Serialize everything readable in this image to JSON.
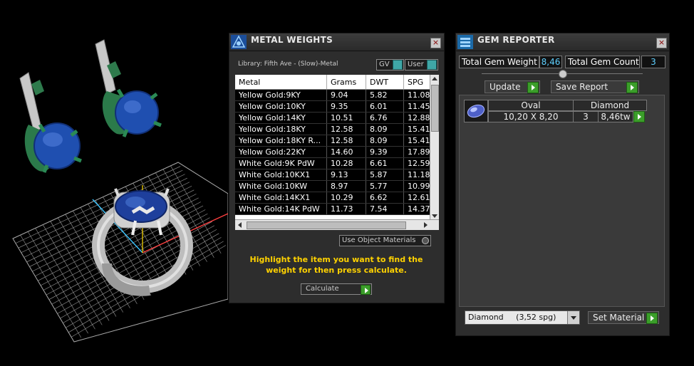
{
  "metal_weights": {
    "title": "METAL WEIGHTS",
    "library": "Library: Fifth Ave - (Slow)-Metal",
    "gv_label": "GV",
    "user_label": "User",
    "columns": [
      "Metal",
      "Grams",
      "DWT",
      "SPG"
    ],
    "rows": [
      [
        "Yellow Gold:9KY",
        "9.04",
        "5.82",
        "11.08"
      ],
      [
        "Yellow Gold:10KY",
        "9.35",
        "6.01",
        "11.45"
      ],
      [
        "Yellow Gold:14KY",
        "10.51",
        "6.76",
        "12.88"
      ],
      [
        "Yellow Gold:18KY",
        "12.58",
        "8.09",
        "15.41"
      ],
      [
        "Yellow Gold:18KY R...",
        "12.58",
        "8.09",
        "15.41"
      ],
      [
        "Yellow Gold:22KY",
        "14.60",
        "9.39",
        "17.89"
      ],
      [
        "White Gold:9K PdW",
        "10.28",
        "6.61",
        "12.59"
      ],
      [
        "White Gold:10KX1",
        "9.13",
        "5.87",
        "11.18"
      ],
      [
        "White Gold:10KW",
        "8.97",
        "5.77",
        "10.99"
      ],
      [
        "White Gold:14KX1",
        "10.29",
        "6.62",
        "12.61"
      ],
      [
        "White Gold:14K PdW",
        "11.73",
        "7.54",
        "14.37"
      ]
    ],
    "use_object_materials": "Use Object Materials",
    "hint": "Highlight the item you want to find the weight for then press calculate.",
    "calculate_label": "Calculate"
  },
  "gem_reporter": {
    "title": "GEM REPORTER",
    "total_weight_label": "Total Gem Weight",
    "total_weight_value": "8,46",
    "total_count_label": "Total Gem Count",
    "total_count_value": "3",
    "update_label": "Update",
    "save_report_label": "Save Report",
    "gem_shape": "Oval",
    "gem_material": "Diamond",
    "gem_size": "10,20 X 8,20",
    "gem_count": "3",
    "gem_weight": "8,46tw",
    "material_select": "Diamond     (3,52 spg)",
    "set_material_label": "Set Material"
  },
  "colors": {
    "panel_bg": "#2d2d2d",
    "accent_green": "#3b9e2a",
    "value_cyan": "#5fd0ff",
    "hint_yellow": "#ffd200"
  }
}
